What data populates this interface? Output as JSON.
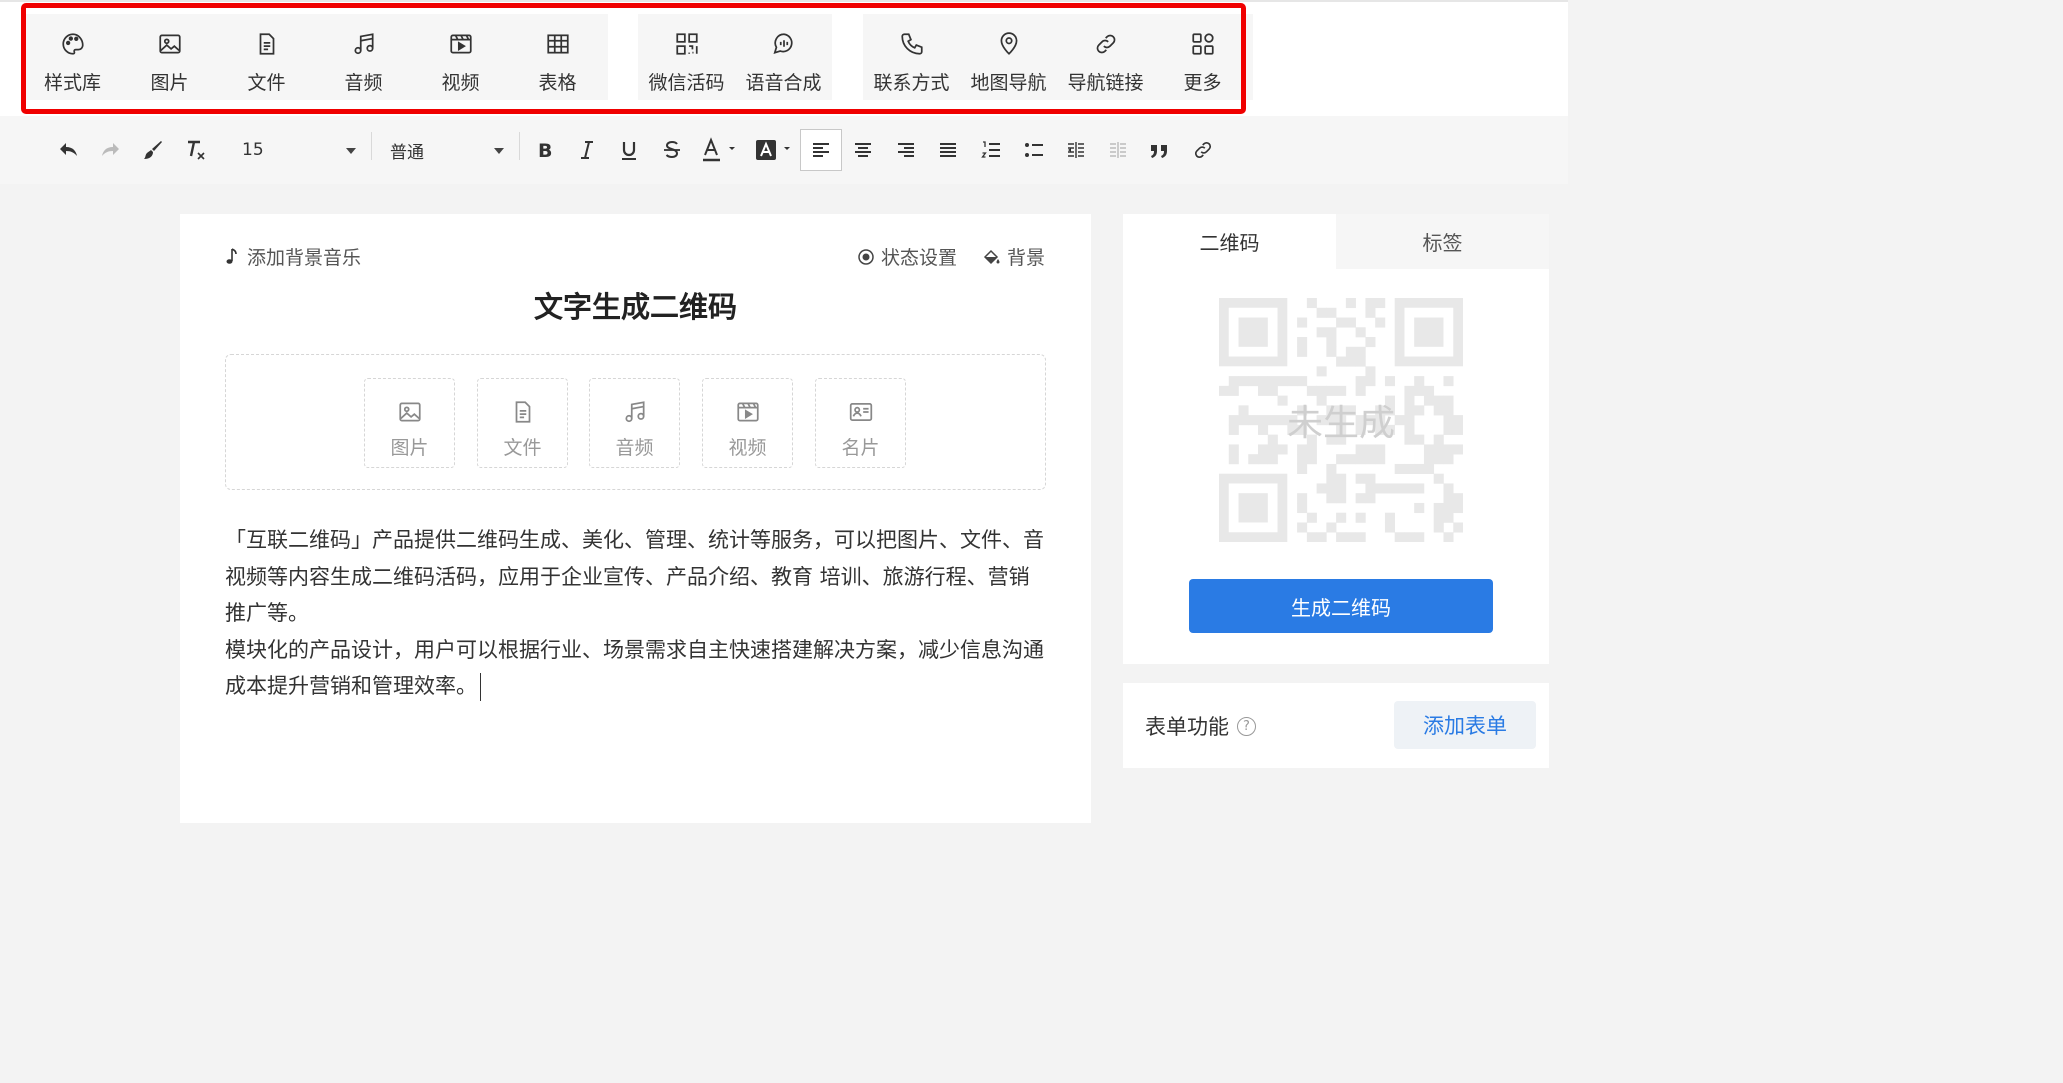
{
  "toolbar_primary": {
    "group1": [
      {
        "label": "样式库",
        "icon": "palette-icon"
      },
      {
        "label": "图片",
        "icon": "image-icon"
      },
      {
        "label": "文件",
        "icon": "file-icon"
      },
      {
        "label": "音频",
        "icon": "music-icon"
      },
      {
        "label": "视频",
        "icon": "video-icon"
      },
      {
        "label": "表格",
        "icon": "table-icon"
      }
    ],
    "group2": [
      {
        "label": "微信活码",
        "icon": "qrcode-icon"
      },
      {
        "label": "语音合成",
        "icon": "speech-icon"
      }
    ],
    "group3": [
      {
        "label": "联系方式",
        "icon": "phone-icon"
      },
      {
        "label": "地图导航",
        "icon": "map-pin-icon"
      },
      {
        "label": "导航链接",
        "icon": "link-icon"
      },
      {
        "label": "更多",
        "icon": "grid-more-icon"
      }
    ],
    "highlight_color": "#f00000"
  },
  "toolbar_format": {
    "font_size": "15",
    "paragraph_style": "普通"
  },
  "editor": {
    "add_bgm": "添加背景音乐",
    "status_settings": "状态设置",
    "background": "背景",
    "title": "文字生成二维码",
    "media": [
      {
        "label": "图片",
        "icon": "image-icon"
      },
      {
        "label": "文件",
        "icon": "file-icon"
      },
      {
        "label": "音频",
        "icon": "music-icon"
      },
      {
        "label": "视频",
        "icon": "video-icon"
      },
      {
        "label": "名片",
        "icon": "card-icon"
      }
    ],
    "paragraphs": [
      "「互联二维码」产品提供二维码生成、美化、管理、统计等服务，可以把图片、文件、音视频等内容生成二维码活码，应用于企业宣传、产品介绍、教育 培训、旅游行程、营销推广等。",
      "模块化的产品设计，用户可以根据行业、场景需求自主快速搭建解决方案，减少信息沟通成本提升营销和管理效率。"
    ]
  },
  "qr_panel": {
    "tabs": [
      "二维码",
      "标签"
    ],
    "placeholder": "未生成",
    "generate_button": "生成二维码",
    "accent_color": "#2a7be4"
  },
  "form_panel": {
    "label": "表单功能",
    "help": "?",
    "add_button": "添加表单"
  }
}
